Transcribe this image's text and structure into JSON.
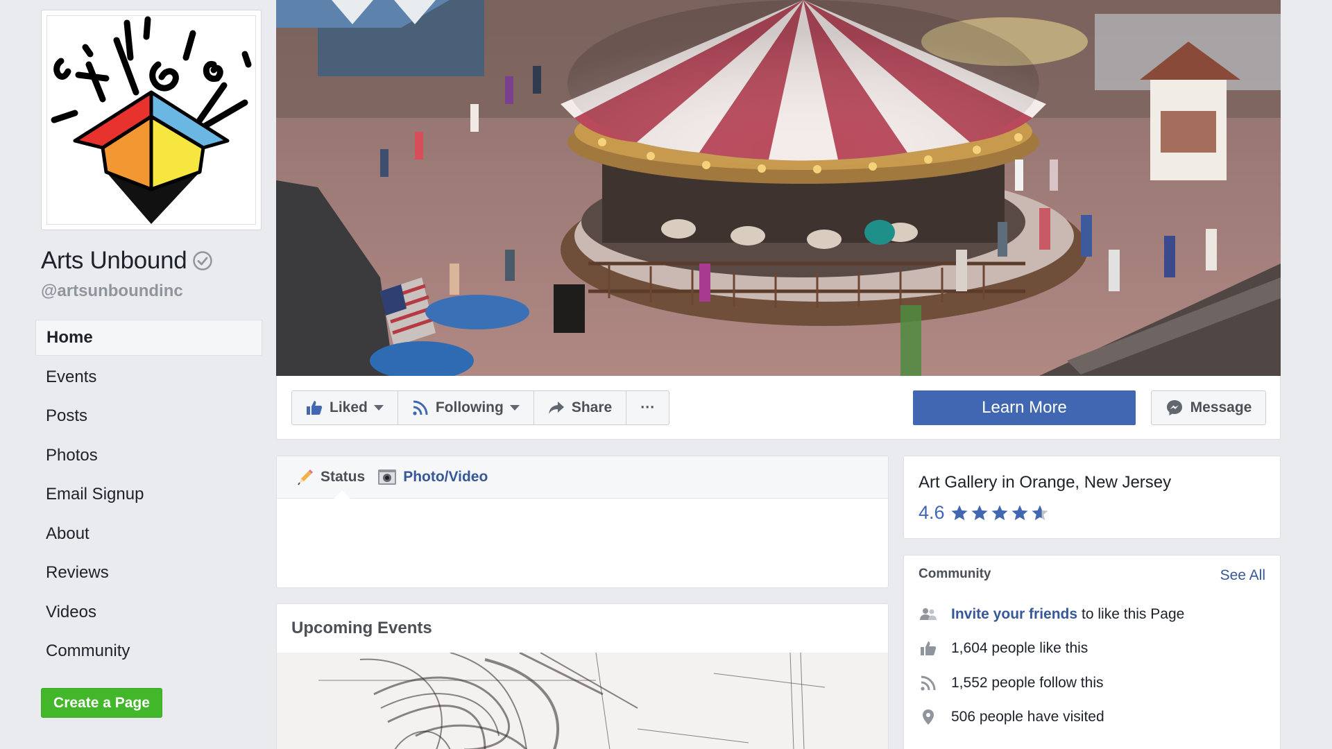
{
  "page": {
    "name": "Arts Unbound",
    "handle": "@artsunboundinc"
  },
  "sidebar": {
    "items": [
      {
        "label": "Home",
        "active": true
      },
      {
        "label": "Events"
      },
      {
        "label": "Posts"
      },
      {
        "label": "Photos"
      },
      {
        "label": "Email Signup"
      },
      {
        "label": "About"
      },
      {
        "label": "Reviews"
      },
      {
        "label": "Videos"
      },
      {
        "label": "Community"
      }
    ],
    "create_page_label": "Create a Page"
  },
  "actions": {
    "liked_label": "Liked",
    "following_label": "Following",
    "share_label": "Share",
    "more_label": "···",
    "learn_more_label": "Learn More",
    "message_label": "Message"
  },
  "composer": {
    "status_label": "Status",
    "photo_video_label": "Photo/Video"
  },
  "events": {
    "title": "Upcoming Events"
  },
  "about": {
    "category": "Art Gallery in Orange, New Jersey",
    "rating": "4.6",
    "rating_value": 4.6,
    "rating_max": 5
  },
  "community": {
    "title": "Community",
    "see_all_label": "See All",
    "invite_link": "Invite your friends",
    "invite_rest": "to like this Page",
    "likes_text": "1,604 people like this",
    "follows_text": "1,552 people follow this",
    "visits_text": "506 people have visited"
  },
  "colors": {
    "background": "#e9ebee",
    "brand_blue": "#4267b2",
    "link_blue": "#365899",
    "green": "#42b72a"
  },
  "icons": {
    "verified": "verified-check-icon",
    "liked": "thumbs-up-icon",
    "following": "rss-icon",
    "share": "share-arrow-icon",
    "message": "messenger-icon",
    "status": "pencil-icon",
    "photo": "camera-icon",
    "invite": "friends-icon",
    "likes": "thumbs-up-icon",
    "follows": "rss-icon",
    "visits": "map-pin-icon"
  }
}
